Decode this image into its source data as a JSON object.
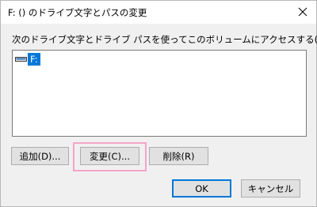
{
  "window": {
    "title": "F: () のドライブ文字とパスの変更",
    "close_glyph": "✕"
  },
  "instruction": "次のドライブ文字とドライブ パスを使ってこのボリュームにアクセスする(A):",
  "list": {
    "items": [
      {
        "label": "F:",
        "icon": "drive-icon",
        "selected": true
      }
    ]
  },
  "buttons": {
    "add": "追加(D)...",
    "change": "変更(C)...",
    "remove": "削除(R)",
    "ok": "OK",
    "cancel": "キャンセル"
  },
  "colors": {
    "selection": "#0078d7",
    "highlight_frame": "#f5a4c9",
    "default_button_border": "#0078d7"
  }
}
